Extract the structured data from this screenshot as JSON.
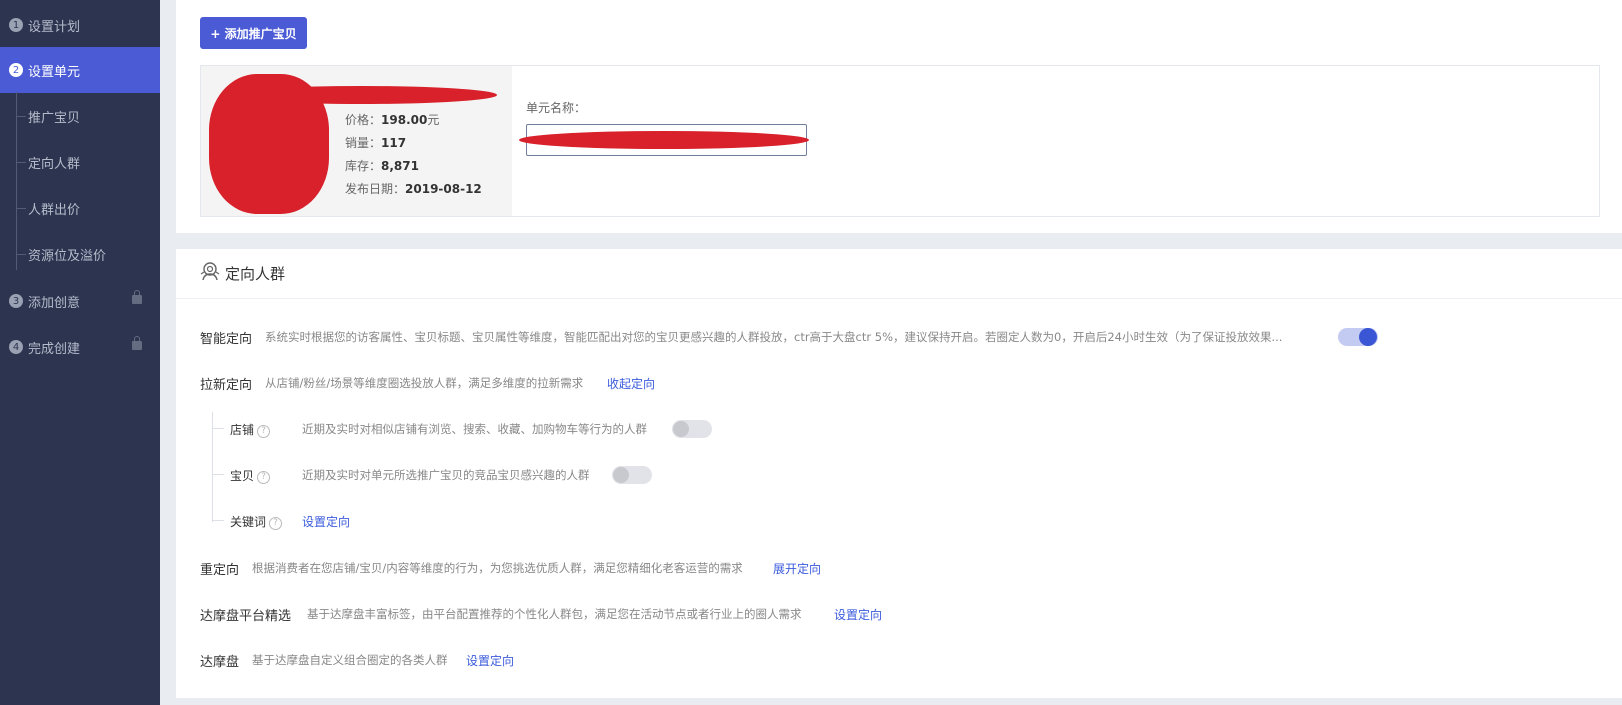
{
  "sidebar": {
    "steps": [
      {
        "num": "1",
        "label": "设置计划"
      },
      {
        "num": "2",
        "label": "设置单元"
      },
      {
        "num": "3",
        "label": "添加创意"
      },
      {
        "num": "4",
        "label": "完成创建"
      }
    ],
    "substeps": [
      "推广宝贝",
      "定向人群",
      "人群出价",
      "资源位及溢价"
    ]
  },
  "product": {
    "add_button": "+ 添加推广宝贝",
    "price_label": "价格：",
    "price_value": "198.00",
    "price_unit": "元",
    "sales_label": "销量：",
    "sales_value": "117",
    "stock_label": "库存：",
    "stock_value": "8,871",
    "date_label": "发布日期：",
    "date_value": "2019-08-12",
    "unit_name_label": "单元名称："
  },
  "targeting": {
    "title": "定向人群",
    "smart": {
      "label": "智能定向",
      "desc": "系统实时根据您的访客属性、宝贝标题、宝贝属性等维度，智能匹配出对您的宝贝更感兴趣的人群投放，ctr高于大盘ctr 5%，建议保持开启。若圈定人数为0，开启后24小时生效（为了保证投放效果...",
      "enabled": true
    },
    "new": {
      "label": "拉新定向",
      "desc": "从店铺/粉丝/场景等维度圈选投放人群，满足多维度的拉新需求",
      "link": "收起定向",
      "items": [
        {
          "label": "店铺",
          "help": "?",
          "desc": "近期及实时对相似店铺有浏览、搜索、收藏、加购物车等行为的人群",
          "enabled": false
        },
        {
          "label": "宝贝",
          "help": "?",
          "desc": "近期及实时对单元所选推广宝贝的竞品宝贝感兴趣的人群",
          "enabled": false
        },
        {
          "label": "关键词",
          "help": "?",
          "link": "设置定向"
        }
      ]
    },
    "retarget": {
      "label": "重定向",
      "desc": "根据消费者在您店铺/宝贝/内容等维度的行为，为您挑选优质人群，满足您精细化老客运营的需求",
      "link": "展开定向"
    },
    "damo_select": {
      "label": "达摩盘平台精选",
      "desc": "基于达摩盘丰富标签，由平台配置推荐的个性化人群包，满足您在活动节点或者行业上的圈人需求",
      "link": "设置定向"
    },
    "damo": {
      "label": "达摩盘",
      "desc": "基于达摩盘自定义组合圈定的各类人群",
      "link": "设置定向"
    }
  },
  "colors": {
    "sidebar_bg": "#2c3450",
    "accent": "#4b5bd6",
    "link": "#3b5bdb"
  }
}
